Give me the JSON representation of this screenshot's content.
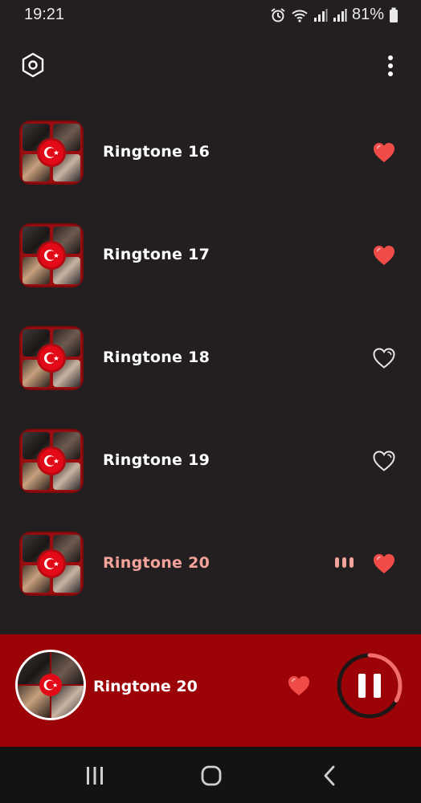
{
  "status_bar": {
    "time": "19:21",
    "battery_percent": "81%",
    "icons": [
      "alarm-icon",
      "wifi-icon",
      "signal-icon",
      "signal-icon",
      "battery-icon"
    ]
  },
  "top_bar": {
    "left_icon": "settings-hexagon-icon",
    "right_icon": "more-vertical-icon"
  },
  "ringtones": [
    {
      "label": "Ringtone 16",
      "favorite": true,
      "playing": false
    },
    {
      "label": "Ringtone 17",
      "favorite": true,
      "playing": false
    },
    {
      "label": "Ringtone 18",
      "favorite": false,
      "playing": false
    },
    {
      "label": "Ringtone 19",
      "favorite": false,
      "playing": false
    },
    {
      "label": "Ringtone 20",
      "favorite": true,
      "playing": true
    }
  ],
  "now_playing": {
    "title": "Ringtone 20",
    "favorite": true,
    "state": "playing",
    "progress": 0.33
  },
  "nav_bar": {
    "icons": [
      "recent-apps-icon",
      "home-icon",
      "back-icon"
    ]
  },
  "colors": {
    "background": "#231f20",
    "player_bar": "#9b0306",
    "heart_filled": "#ef4b48",
    "active_label": "#f4a39a",
    "thumb_red": "#9a0d10"
  }
}
